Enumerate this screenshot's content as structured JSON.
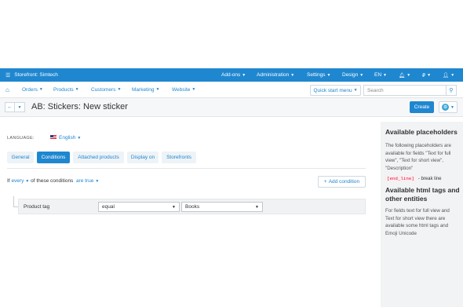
{
  "topbar": {
    "storefront_label": "Storefront: Simtech",
    "menus": [
      "Add-ons",
      "Administration",
      "Settings",
      "Design",
      "EN",
      "₽"
    ],
    "bg_color": "#1f87d0"
  },
  "nav": {
    "items": [
      "Orders",
      "Products",
      "Customers",
      "Marketing",
      "Website"
    ],
    "quick_start": "Quick start menu",
    "search_placeholder": "Search"
  },
  "title": {
    "text": "AB: Stickers: New sticker",
    "create_label": "Create"
  },
  "language": {
    "label": "LANGUAGE:",
    "value": "English"
  },
  "tabs": [
    "General",
    "Conditions",
    "Attached products",
    "Display on",
    "Storefronts"
  ],
  "active_tab": "Conditions",
  "conditions": {
    "prefix": "If",
    "every": "every",
    "middle": "of these conditions",
    "are_true": "are true",
    "add_label": "Add condition",
    "row": {
      "label": "Product tag",
      "operator": "equal",
      "value": "Books"
    }
  },
  "sidebar": {
    "title1": "Available placeholders",
    "text1": "The following placeholders are available for fields \"Text for full view\", \"Text for short view\", \"Description\"",
    "code": "[end_line]",
    "code_desc": "- break line",
    "title2": "Available html tags and other entities",
    "text2": "For fields  text for full view and Text for short view there are available some html tags and Emoji Unicode"
  }
}
